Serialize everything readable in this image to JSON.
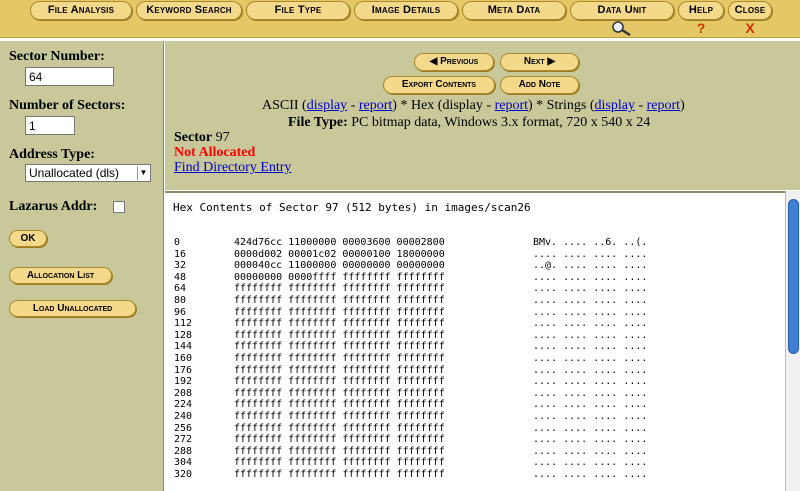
{
  "tabs": {
    "file_analysis": "File Analysis",
    "keyword_search": "Keyword Search",
    "file_type": "File Type",
    "image_details": "Image Details",
    "meta_data": "Meta Data",
    "data_unit": "Data Unit",
    "help": "Help",
    "help_icon": "?",
    "close": "Close",
    "close_icon": "X"
  },
  "left": {
    "sector_number_label": "Sector Number:",
    "sector_number_value": "64",
    "num_sectors_label": "Number of Sectors:",
    "num_sectors_value": "1",
    "address_type_label": "Address Type:",
    "address_type_value": "Unallocated (dls)",
    "lazarus_label": "Lazarus Addr:",
    "ok_button": "OK",
    "allocation_list_button": "Allocation List",
    "load_unallocated_button": "Load Unallocated"
  },
  "nav": {
    "previous": "Previous",
    "next": "Next",
    "export_contents": "Export Contents",
    "add_note": "Add Note"
  },
  "view": {
    "ascii": "ASCII (",
    "display": "display",
    "dash": " - ",
    "report": "report",
    "close_hex": ") * Hex (display - ",
    "close_strings": ") * Strings (",
    "end": ")"
  },
  "file_type": {
    "label": "File Type:",
    "value": " PC bitmap data, Windows 3.x format, 720 x 540 x 24"
  },
  "sector": {
    "label": "Sector",
    "value": " 97",
    "status": "Not Allocated",
    "find_dir_entry": "Find Directory Entry"
  },
  "hex": {
    "title": "Hex Contents of Sector 97 (512 bytes) in images/scan26",
    "rows": [
      {
        "off": "0",
        "hex": "424d76cc 11000000 00003600 00002800",
        "asc": "BMv. .... ..6. ..(."
      },
      {
        "off": "16",
        "hex": "0000d002 00001c02 00000100 18000000",
        "asc": ".... .... .... ...."
      },
      {
        "off": "32",
        "hex": "000040cc 11000000 00000000 00000000",
        "asc": "..@. .... .... ...."
      },
      {
        "off": "48",
        "hex": "00000000 0000ffff ffffffff ffffffff",
        "asc": ".... .... .... ...."
      },
      {
        "off": "64",
        "hex": "ffffffff ffffffff ffffffff ffffffff",
        "asc": ".... .... .... ...."
      },
      {
        "off": "80",
        "hex": "ffffffff ffffffff ffffffff ffffffff",
        "asc": ".... .... .... ...."
      },
      {
        "off": "96",
        "hex": "ffffffff ffffffff ffffffff ffffffff",
        "asc": ".... .... .... ...."
      },
      {
        "off": "112",
        "hex": "ffffffff ffffffff ffffffff ffffffff",
        "asc": ".... .... .... ...."
      },
      {
        "off": "128",
        "hex": "ffffffff ffffffff ffffffff ffffffff",
        "asc": ".... .... .... ...."
      },
      {
        "off": "144",
        "hex": "ffffffff ffffffff ffffffff ffffffff",
        "asc": ".... .... .... ...."
      },
      {
        "off": "160",
        "hex": "ffffffff ffffffff ffffffff ffffffff",
        "asc": ".... .... .... ...."
      },
      {
        "off": "176",
        "hex": "ffffffff ffffffff ffffffff ffffffff",
        "asc": ".... .... .... ...."
      },
      {
        "off": "192",
        "hex": "ffffffff ffffffff ffffffff ffffffff",
        "asc": ".... .... .... ...."
      },
      {
        "off": "208",
        "hex": "ffffffff ffffffff ffffffff ffffffff",
        "asc": ".... .... .... ...."
      },
      {
        "off": "224",
        "hex": "ffffffff ffffffff ffffffff ffffffff",
        "asc": ".... .... .... ...."
      },
      {
        "off": "240",
        "hex": "ffffffff ffffffff ffffffff ffffffff",
        "asc": ".... .... .... ...."
      },
      {
        "off": "256",
        "hex": "ffffffff ffffffff ffffffff ffffffff",
        "asc": ".... .... .... ...."
      },
      {
        "off": "272",
        "hex": "ffffffff ffffffff ffffffff ffffffff",
        "asc": ".... .... .... ...."
      },
      {
        "off": "288",
        "hex": "ffffffff ffffffff ffffffff ffffffff",
        "asc": ".... .... .... ...."
      },
      {
        "off": "304",
        "hex": "ffffffff ffffffff ffffffff ffffffff",
        "asc": ".... .... .... ...."
      },
      {
        "off": "320",
        "hex": "ffffffff ffffffff ffffffff ffffffff",
        "asc": ".... .... .... ...."
      }
    ]
  },
  "colors": {
    "panel": "#c9c89a",
    "tab": "#f4d98a",
    "tab_bar": "#e4c766",
    "not_allocated": "#ff0000",
    "link": "#0000cc",
    "scroll_thumb": "#3f7fd4"
  },
  "icons": {
    "data_unit": "magnifier-icon",
    "previous": "arrow-left-icon",
    "next": "arrow-right-icon"
  }
}
